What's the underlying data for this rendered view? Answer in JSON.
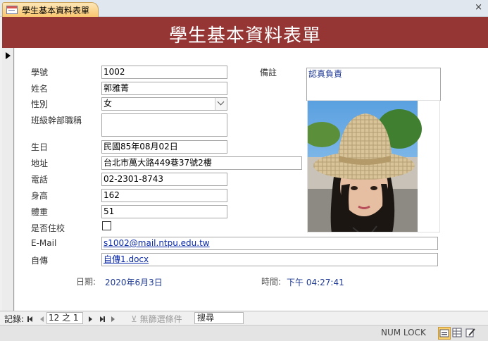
{
  "tab": {
    "title": "學生基本資料表單",
    "close_glyph": "×"
  },
  "form": {
    "title": "學生基本資料表單"
  },
  "fields": {
    "student_id": {
      "label": "學號",
      "value": "1002"
    },
    "name": {
      "label": "姓名",
      "value": "郭雅菁"
    },
    "gender": {
      "label": "性別",
      "value": "女"
    },
    "cadre": {
      "label": "班級幹部職稱",
      "value": ""
    },
    "birthday": {
      "label": "生日",
      "value": "民國85年08月02日"
    },
    "address": {
      "label": "地址",
      "value": "台北市萬大路449巷37號2樓"
    },
    "phone": {
      "label": "電話",
      "value": "02-2301-8743"
    },
    "height": {
      "label": "身高",
      "value": "162"
    },
    "weight": {
      "label": "體重",
      "value": "51"
    },
    "boarding": {
      "label": "是否住校",
      "checked": false
    },
    "email": {
      "label": "E-Mail",
      "value": "s1002@mail.ntpu.edu.tw"
    },
    "autobiography": {
      "label": "自傳",
      "value": "自傳1.docx"
    },
    "remarks": {
      "label": "備註",
      "value": "認真負責"
    }
  },
  "footer": {
    "date_label": "日期:",
    "date_value": "2020年6月3日",
    "time_label": "時間:",
    "time_value": "下午 04:27:41"
  },
  "navigation": {
    "record_label": "記錄:",
    "record_position": "12 之 1",
    "filter_label": "無篩選條件",
    "search_placeholder": "搜尋"
  },
  "status_bar": {
    "num_lock": "NUM LOCK"
  },
  "colors": {
    "header": "#963634",
    "link": "#0b2aa8",
    "active_view": "#f9cf6b"
  }
}
